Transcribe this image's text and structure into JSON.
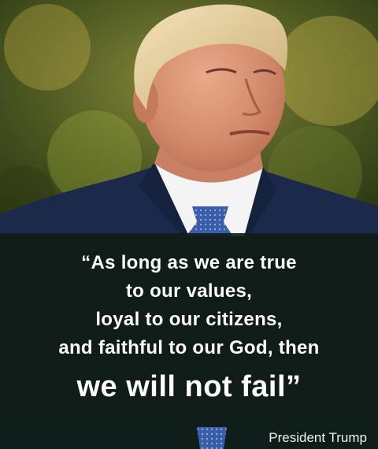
{
  "quote": {
    "line1": "“As long as we are true",
    "line2": "to our values,",
    "line3": "loyal to our citizens,",
    "line4": "and faithful to our God, then",
    "line5": "we will not fail”"
  },
  "attribution": "President Trump",
  "colors": {
    "caption_bg": "#0f1c18",
    "text": "#ffffff",
    "suit": "#1b2a4a",
    "tie": "#3b5ea8"
  }
}
